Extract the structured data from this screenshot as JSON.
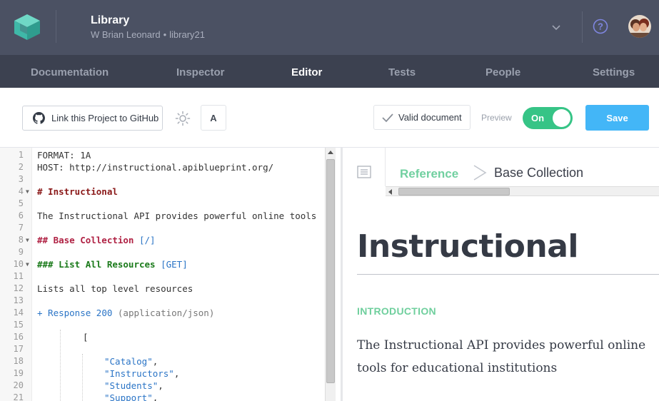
{
  "header": {
    "project_title": "Library",
    "owner": "W Brian Leonard",
    "separator": "•",
    "project_slug": "library21"
  },
  "nav": {
    "tabs": [
      {
        "label": "Documentation",
        "active": false
      },
      {
        "label": "Inspector",
        "active": false
      },
      {
        "label": "Editor",
        "active": true
      },
      {
        "label": "Tests",
        "active": false
      },
      {
        "label": "People",
        "active": false
      },
      {
        "label": "Settings",
        "active": false
      }
    ]
  },
  "toolbar": {
    "github_label": "Link this Project to GitHub",
    "font_label": "A",
    "valid_label": "Valid document",
    "preview_label": "Preview",
    "toggle_label": "On",
    "save_label": "Save"
  },
  "editor": {
    "lines": [
      {
        "n": "1",
        "fold": false,
        "text": "FORMAT: 1A"
      },
      {
        "n": "2",
        "fold": false,
        "text": "HOST: http://instructional.apiblueprint.org/"
      },
      {
        "n": "3",
        "fold": false,
        "text": ""
      },
      {
        "n": "4",
        "fold": true,
        "text": "# Instructional"
      },
      {
        "n": "5",
        "fold": false,
        "text": ""
      },
      {
        "n": "6",
        "fold": false,
        "text": "The Instructional API provides powerful online tools"
      },
      {
        "n": "7",
        "fold": false,
        "text": ""
      },
      {
        "n": "8",
        "fold": true,
        "text": "## Base Collection [/]"
      },
      {
        "n": "9",
        "fold": false,
        "text": ""
      },
      {
        "n": "10",
        "fold": true,
        "text": "### List All Resources [GET]"
      },
      {
        "n": "11",
        "fold": false,
        "text": ""
      },
      {
        "n": "12",
        "fold": false,
        "text": "Lists all top level resources"
      },
      {
        "n": "13",
        "fold": false,
        "text": ""
      },
      {
        "n": "14",
        "fold": false,
        "text": "+ Response 200 (application/json)"
      },
      {
        "n": "15",
        "fold": false,
        "text": ""
      },
      {
        "n": "16",
        "fold": false,
        "text": "[",
        "indent": 64
      },
      {
        "n": "17",
        "fold": false,
        "text": ""
      },
      {
        "n": "18",
        "fold": false,
        "text": "\"Catalog\",",
        "indent": 94
      },
      {
        "n": "19",
        "fold": false,
        "text": "\"Instructors\",",
        "indent": 94
      },
      {
        "n": "20",
        "fold": false,
        "text": "\"Students\",",
        "indent": 94
      },
      {
        "n": "21",
        "fold": false,
        "text": "\"Support\",",
        "indent": 94
      }
    ]
  },
  "preview": {
    "breadcrumb_ref": "Reference",
    "breadcrumb_current": "Base Collection",
    "title": "Instructional",
    "section": "INTRODUCTION",
    "body": "The Instructional API provides powerful online tools for educational institutions"
  },
  "colors": {
    "header_bg": "#4b5163",
    "nav_bg": "#3c4150",
    "toggle_on": "#36c486",
    "save_button": "#43b6f7",
    "accent_green": "#71d0a0"
  },
  "icons": [
    "logo-icon",
    "chevron-down-icon",
    "help-icon",
    "avatar",
    "github-icon",
    "sun-icon",
    "check-icon",
    "document-icon",
    "chevron-right-icon"
  ]
}
